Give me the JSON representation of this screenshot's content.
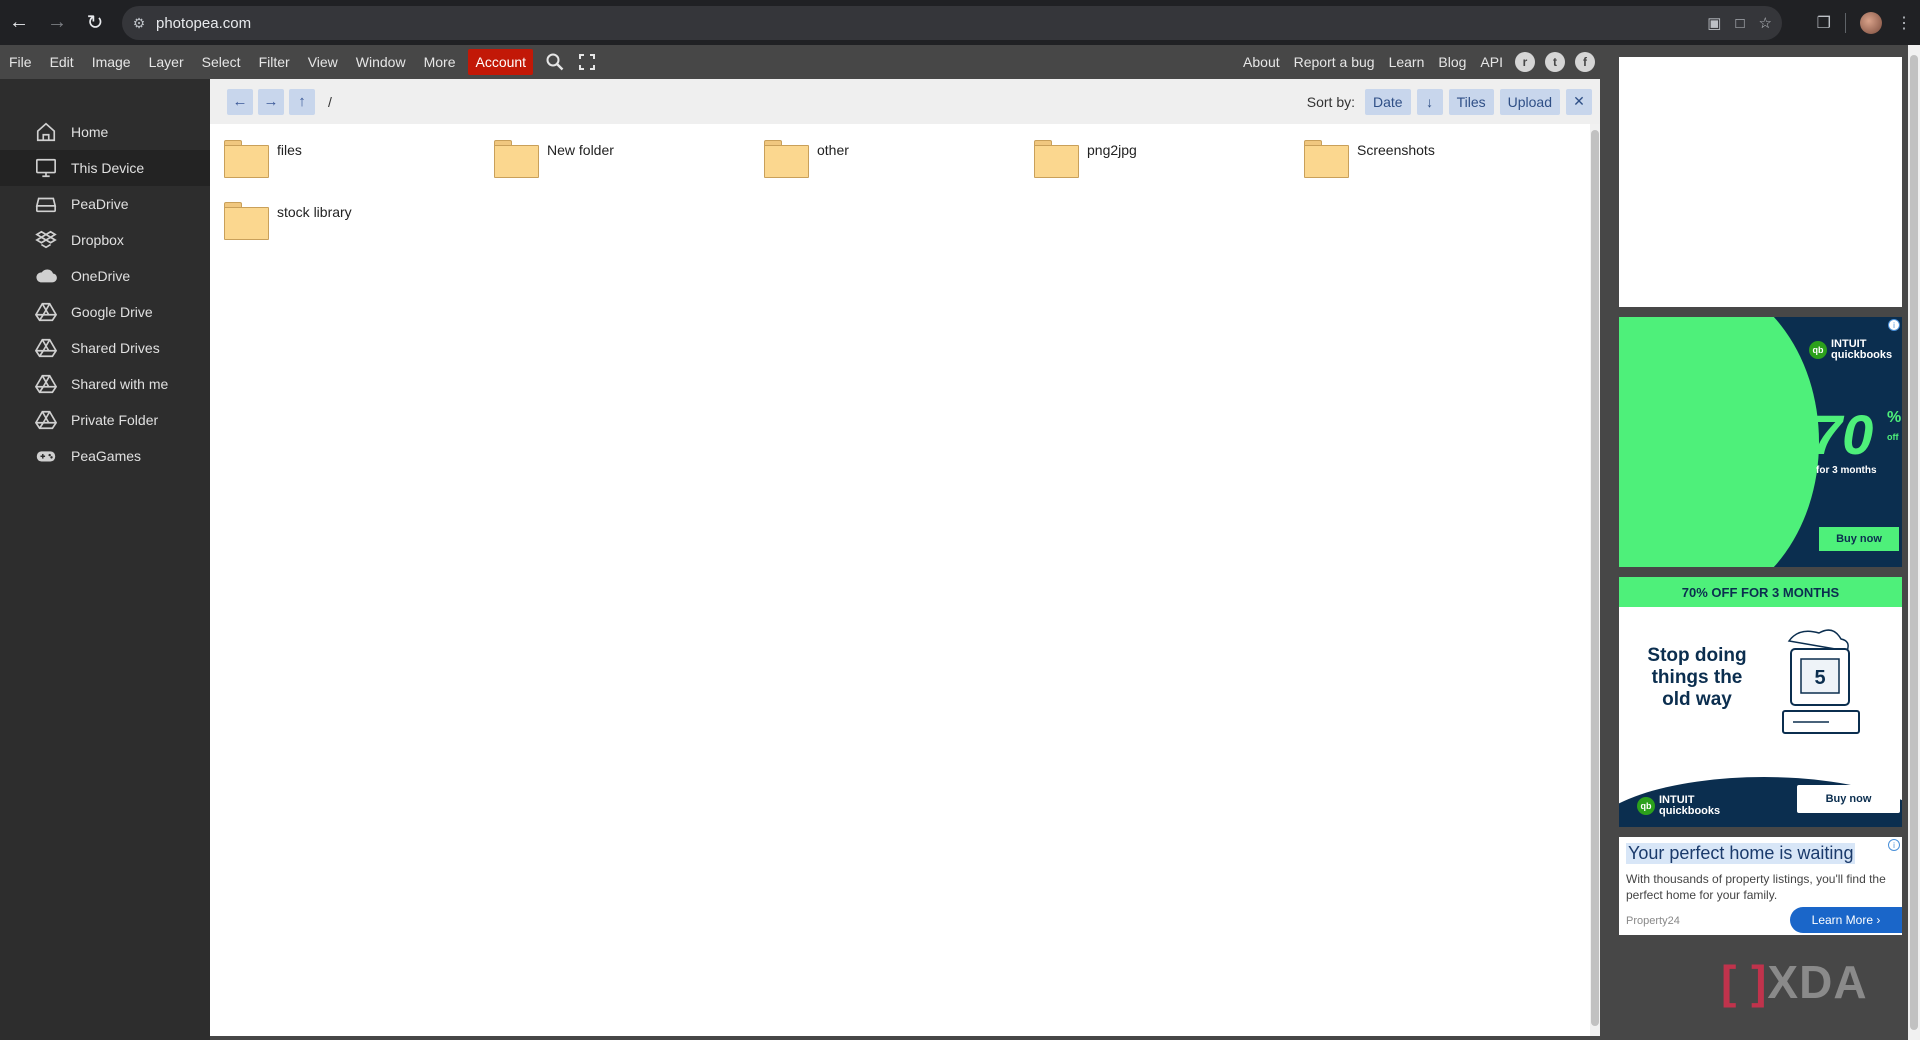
{
  "browser": {
    "url": "photopea.com",
    "icons": [
      "back-arrow-icon",
      "forward-arrow-icon",
      "reload-icon",
      "site-settings-icon",
      "install-app-icon",
      "reader-mode-icon",
      "bookmark-star-icon",
      "extensions-icon",
      "profile-avatar",
      "more-vert-icon"
    ]
  },
  "menubar": {
    "items": [
      "File",
      "Edit",
      "Image",
      "Layer",
      "Select",
      "Filter",
      "View",
      "Window",
      "More"
    ],
    "account": "Account",
    "right_items": [
      "About",
      "Report a bug",
      "Learn",
      "Blog",
      "API"
    ],
    "socials": [
      "reddit-icon",
      "twitter-icon",
      "facebook-icon"
    ]
  },
  "sidebar": {
    "items": [
      {
        "label": "Home",
        "icon": "home-icon"
      },
      {
        "label": "This Device",
        "icon": "monitor-icon"
      },
      {
        "label": "PeaDrive",
        "icon": "drive-icon"
      },
      {
        "label": "Dropbox",
        "icon": "dropbox-icon"
      },
      {
        "label": "OneDrive",
        "icon": "cloud-icon"
      },
      {
        "label": "Google Drive",
        "icon": "google-drive-icon"
      },
      {
        "label": "Shared Drives",
        "icon": "google-drive-icon"
      },
      {
        "label": "Shared with me",
        "icon": "google-drive-icon"
      },
      {
        "label": "Private Folder",
        "icon": "google-drive-icon"
      },
      {
        "label": "PeaGames",
        "icon": "gamepad-icon"
      }
    ],
    "active_index": 1
  },
  "toolbar": {
    "path": "/",
    "sort_label": "Sort by:",
    "sort_value": "Date",
    "view_mode": "Tiles",
    "upload": "Upload"
  },
  "folders": [
    "files",
    "New folder",
    "other",
    "png2jpg",
    "Screenshots",
    "stock library"
  ],
  "ads": {
    "qb1": {
      "brand_top": "INTUIT",
      "brand": "quickbooks",
      "big": "70",
      "pct": "%",
      "off": "off",
      "months": "for 3 months",
      "cta": "Buy now"
    },
    "qb2": {
      "banner": "70% OFF FOR 3 MONTHS",
      "headline": "Stop doing things the old way",
      "screen_number": "5",
      "brand_top": "INTUIT",
      "brand": "quickbooks",
      "cta": "Buy now"
    },
    "property": {
      "title": "Your perfect home is waiting",
      "desc": "With thousands of property listings, you'll find the perfect home for your family.",
      "brand": "Property24",
      "cta": "Learn More"
    }
  },
  "watermark": "XDA",
  "colors": {
    "account": "#c21807",
    "folder": "#fbd78f",
    "accent_button": "#c8d6ec",
    "qb_green": "#4ef07a",
    "qb_navy": "#0b2e4f"
  }
}
